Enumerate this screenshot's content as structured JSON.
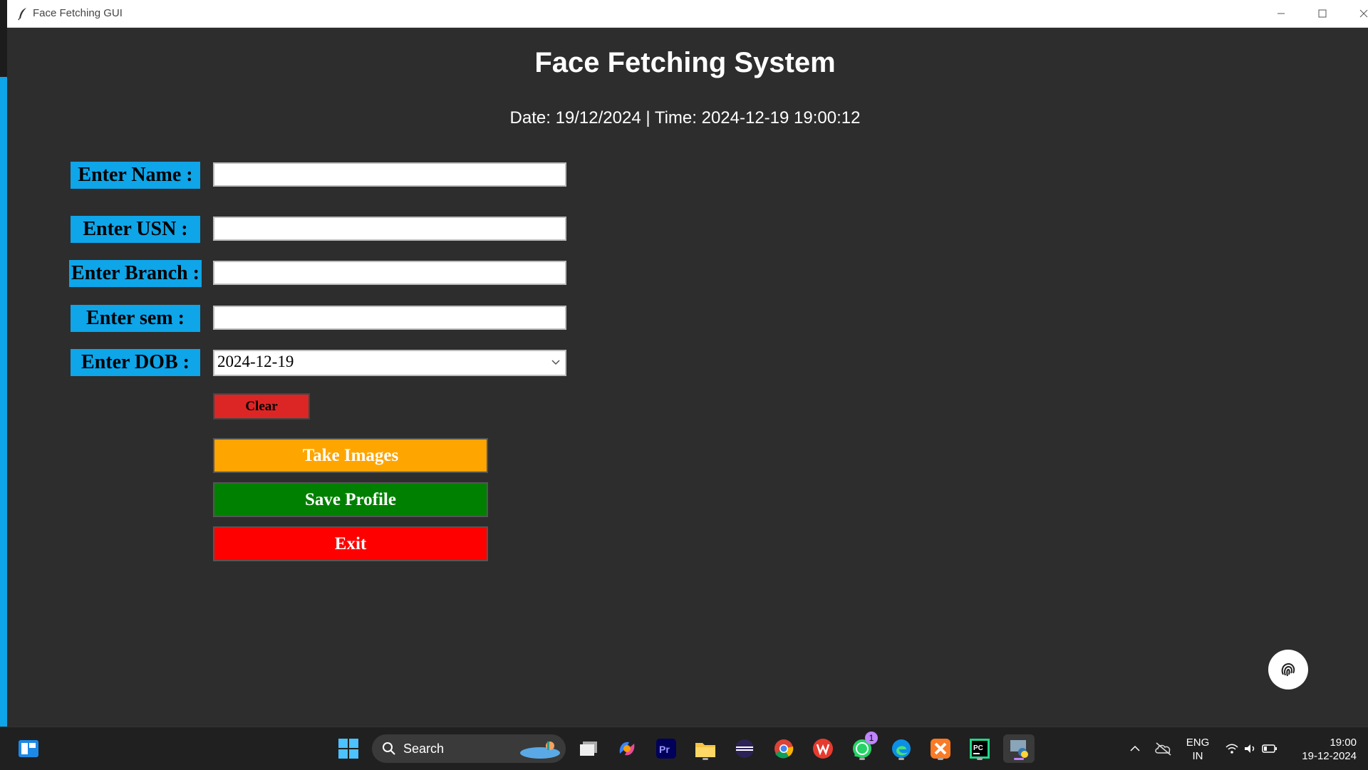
{
  "window": {
    "title": "Face Fetching GUI"
  },
  "header": {
    "title": "Face Fetching System",
    "datetime": "Date: 19/12/2024 | Time: 2024-12-19 19:00:12"
  },
  "form": {
    "name_label": "Enter Name :",
    "name_value": "",
    "usn_label": "Enter USN :",
    "usn_value": "",
    "branch_label": "Enter Branch :",
    "branch_value": "",
    "sem_label": "Enter sem :",
    "sem_value": "",
    "dob_label": "Enter DOB :",
    "dob_value": "2024-12-19"
  },
  "buttons": {
    "clear": "Clear",
    "take_images": "Take Images",
    "save_profile": "Save Profile",
    "exit": "Exit"
  },
  "taskbar": {
    "search_placeholder": "Search",
    "whatsapp_badge": "1",
    "lang_line1": "ENG",
    "lang_line2": "IN",
    "time": "19:00",
    "date": "19-12-2024"
  },
  "colors": {
    "label_bg": "#0ea5e9",
    "clear": "#dc2626",
    "take_images": "#ffa500",
    "save_profile": "#008000",
    "exit": "#ff0000"
  }
}
